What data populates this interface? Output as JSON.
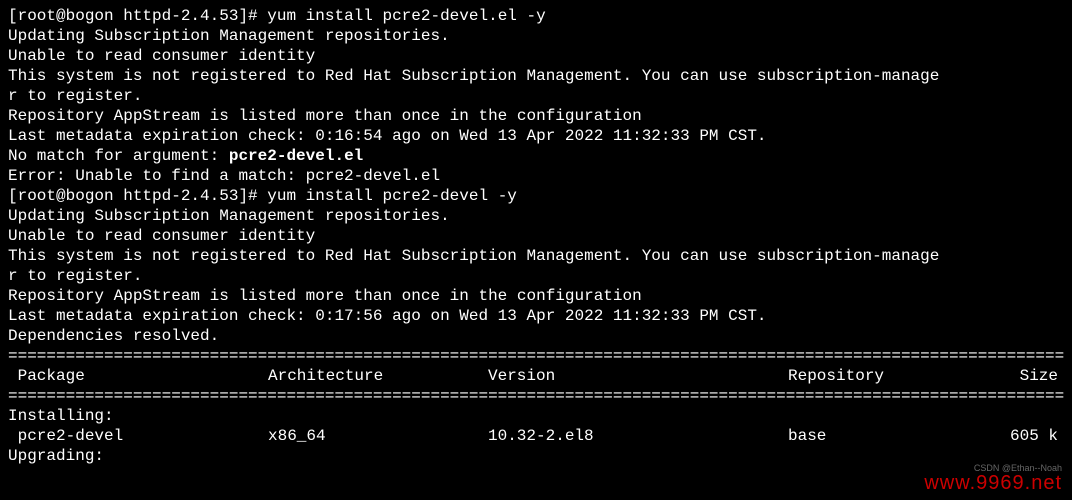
{
  "terminal": {
    "prompt1": "[root@bogon httpd-2.4.53]# ",
    "command1": "yum install pcre2-devel.el -y",
    "line1": "Updating Subscription Management repositories.",
    "line2": "Unable to read consumer identity",
    "line3": "This system is not registered to Red Hat Subscription Management. You can use subscription-manage",
    "line4": "r to register.",
    "line5": "Repository AppStream is listed more than once in the configuration",
    "line6": "Last metadata expiration check: 0:16:54 ago on Wed 13 Apr 2022 11:32:33 PM CST.",
    "line7a": "No match for argument: ",
    "line7b": "pcre2-devel.el",
    "line8": "Error: Unable to find a match: pcre2-devel.el",
    "prompt2": "[root@bogon httpd-2.4.53]# ",
    "command2": "yum install pcre2-devel -y",
    "line9": "Updating Subscription Management repositories.",
    "line10": "Unable to read consumer identity",
    "line11": "This system is not registered to Red Hat Subscription Management. You can use subscription-manage",
    "line12": "r to register.",
    "line13": "Repository AppStream is listed more than once in the configuration",
    "line14": "Last metadata expiration check: 0:17:56 ago on Wed 13 Apr 2022 11:32:33 PM CST.",
    "line15": "Dependencies resolved.",
    "divider": "======================================================================================================================",
    "header": {
      "package": " Package",
      "arch": "Architecture",
      "version": "Version",
      "repo": "Repository",
      "size": "Size"
    },
    "installing_label": "Installing:",
    "row": {
      "package": " pcre2-devel",
      "arch": "x86_64",
      "version": "10.32-2.el8",
      "repo": "base",
      "size": "605 k"
    },
    "upgrading_label": "Upgrading:"
  },
  "watermark": {
    "small": "CSDN @Ethan--Noah",
    "main": "www.9969.net"
  }
}
